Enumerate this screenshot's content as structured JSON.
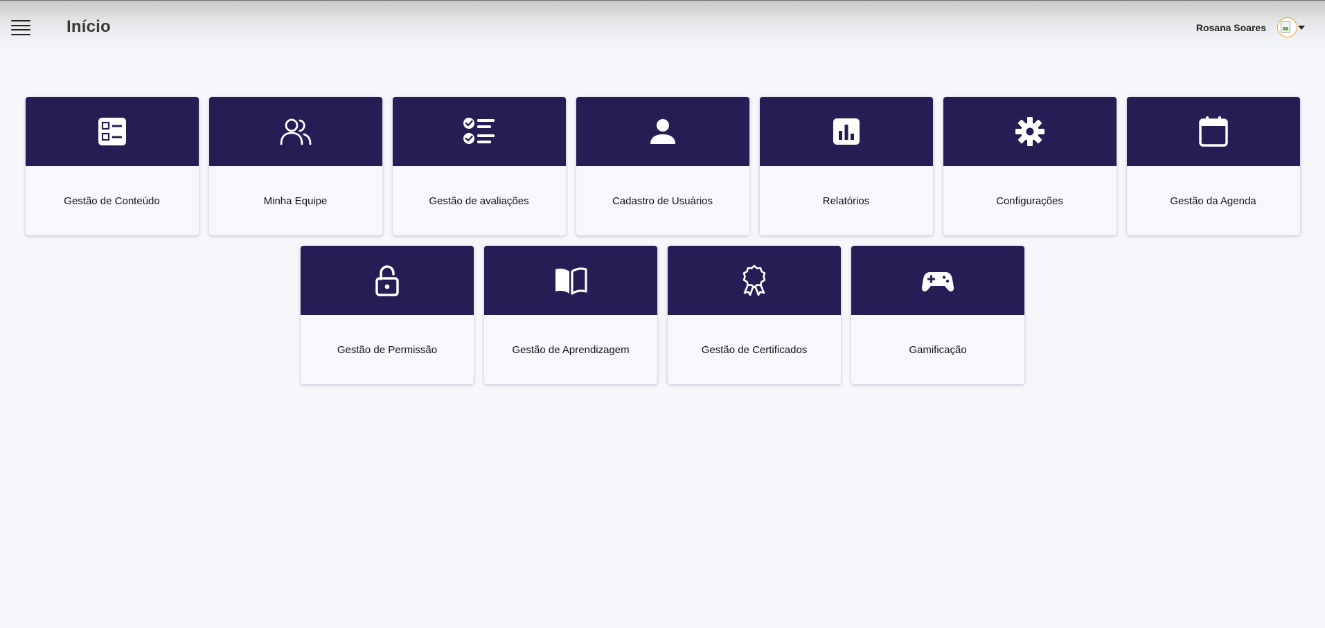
{
  "header": {
    "title": "Início",
    "user_name": "Rosana Soares"
  },
  "colors": {
    "card_header": "#251e55",
    "card_body": "#f7f8fc",
    "background": "#f6f7fb",
    "avatar_ring": "#e0a526"
  },
  "cards": [
    {
      "label": "Gestão de Conteúdo",
      "icon": "content-list-icon"
    },
    {
      "label": "Minha Equipe",
      "icon": "team-icon"
    },
    {
      "label": "Gestão de avaliações",
      "icon": "checklist-icon"
    },
    {
      "label": "Cadastro de Usuários",
      "icon": "user-icon"
    },
    {
      "label": "Relatórios",
      "icon": "bar-chart-icon"
    },
    {
      "label": "Configurações",
      "icon": "gear-icon"
    },
    {
      "label": "Gestão da Agenda",
      "icon": "calendar-icon"
    },
    {
      "label": "Gestão de Permissão",
      "icon": "unlock-icon"
    },
    {
      "label": "Gestão de Aprendizagem",
      "icon": "open-book-icon"
    },
    {
      "label": "Gestão de Certificados",
      "icon": "award-badge-icon"
    },
    {
      "label": "Gamificação",
      "icon": "gamepad-icon"
    }
  ]
}
